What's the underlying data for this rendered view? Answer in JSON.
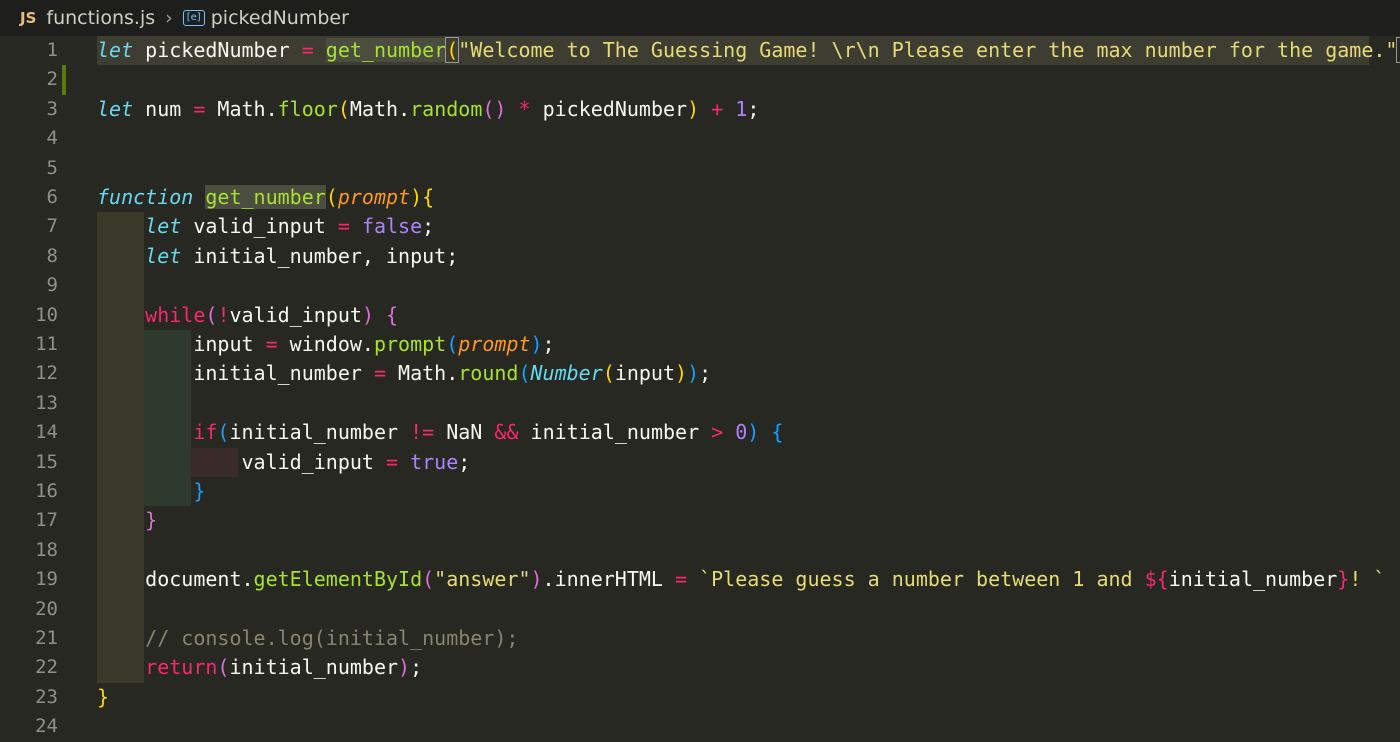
{
  "breadcrumb": {
    "lang_badge": "JS",
    "file": "functions.js",
    "symbol": "pickedNumber"
  },
  "colors": {
    "background": "#272822",
    "keyword": "#66d9ef",
    "function": "#a6e22e",
    "string": "#e6db74",
    "operator": "#f92672",
    "number": "#ae81ff",
    "parameter": "#fd971f",
    "comment": "#88846f"
  },
  "editor": {
    "line_numbers": [
      "1",
      "2",
      "3",
      "4",
      "5",
      "6",
      "7",
      "8",
      "9",
      "10",
      "11",
      "12",
      "13",
      "14",
      "15",
      "16",
      "17",
      "18",
      "19",
      "20",
      "21",
      "22",
      "23",
      "24"
    ]
  }
}
